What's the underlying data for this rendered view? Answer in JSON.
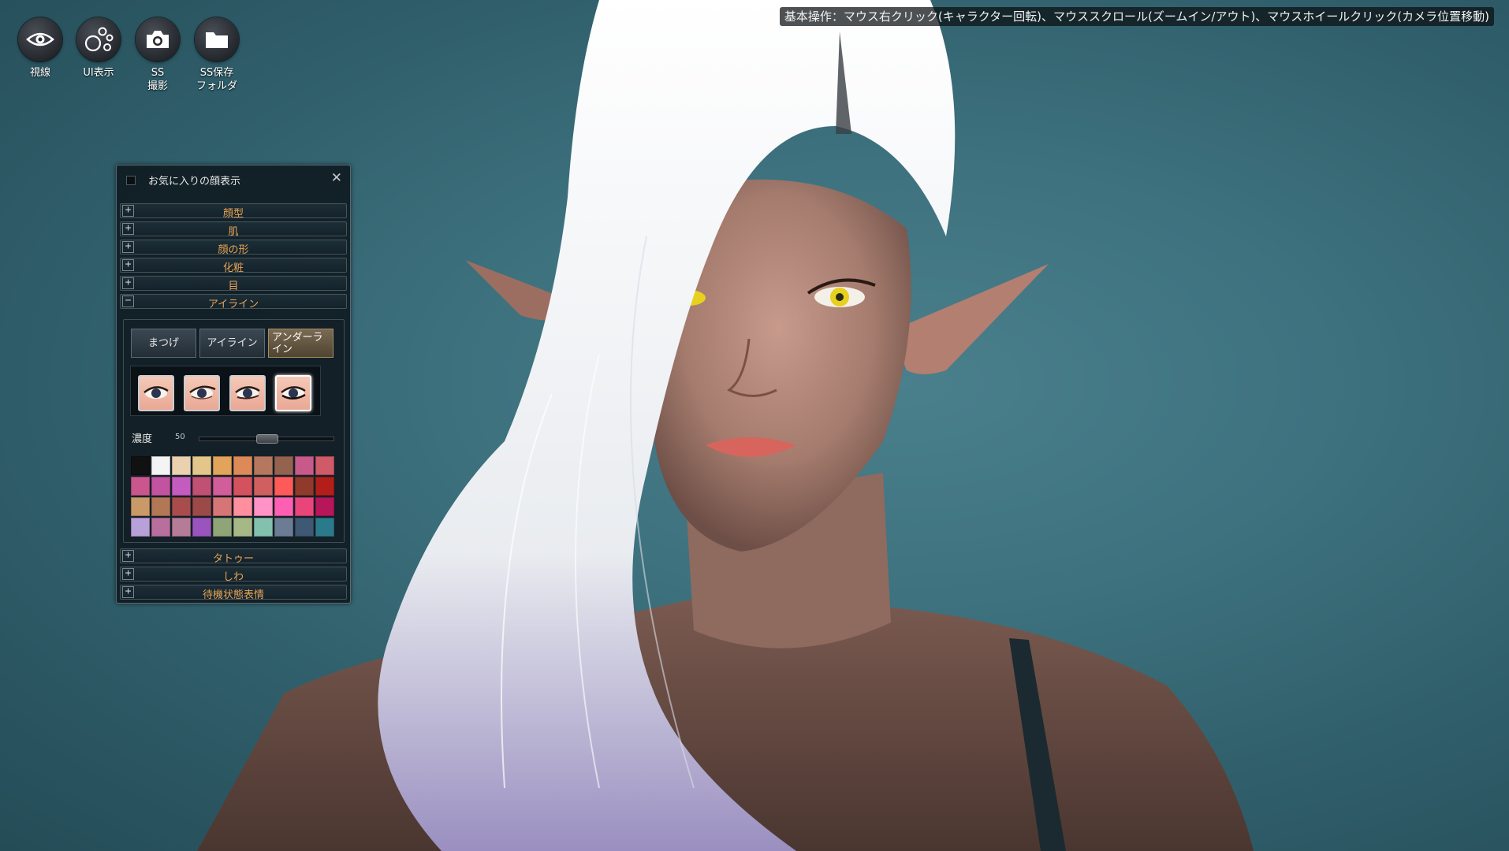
{
  "toolbar": {
    "items": [
      {
        "label": "視線",
        "icon": "eye-icon"
      },
      {
        "label": "UI表示",
        "icon": "bubbles-icon"
      },
      {
        "label": "SS\n撮影",
        "icon": "camera-icon"
      },
      {
        "label": "SS保存\nフォルダ",
        "icon": "folder-icon"
      }
    ]
  },
  "hint": "基本操作：マウス右クリック(キャラクター回転)、マウススクロール(ズームイン/アウト)、マウスホイールクリック(カメラ位置移動)",
  "panel": {
    "favorite_label": "お気に入りの顔表示",
    "close": "✕",
    "sections_top": [
      {
        "label": "顔型",
        "state": "+"
      },
      {
        "label": "肌",
        "state": "+"
      },
      {
        "label": "顔の形",
        "state": "+"
      },
      {
        "label": "化粧",
        "state": "+"
      },
      {
        "label": "目",
        "state": "+"
      },
      {
        "label": "アイライン",
        "state": "−"
      }
    ],
    "tabs": [
      "まつげ",
      "アイライン",
      "アンダーライン"
    ],
    "active_tab": "アンダーライン",
    "eye_options_count": 4,
    "selected_eye_option": 4,
    "density_label": "濃度",
    "density_value": "50",
    "density_fraction": 0.5,
    "palette": [
      [
        "#111111",
        "#f4f4f4",
        "#ead2b0",
        "#e3c78a",
        "#e1a45a",
        "#dd8a58",
        "#b5785f",
        "#94634f",
        "#c75a8b",
        "#cf5a68"
      ],
      [
        "#c9578d",
        "#c153a1",
        "#c45bbf",
        "#c05074",
        "#d15d9a",
        "#d4525e",
        "#d06060",
        "#ff5a5a",
        "#8f3a2a",
        "#b41e1a"
      ],
      [
        "#c99a67",
        "#b27755",
        "#a84c4c",
        "#9c4a48",
        "#d67575",
        "#ff8e9e",
        "#ff92c6",
        "#ff5fb2",
        "#e9457a",
        "#b8165a"
      ],
      [
        "#b8a0d8",
        "#b96f9e",
        "#b47c97",
        "#9a54be",
        "#90a577",
        "#a6b886",
        "#84c0ae",
        "#6c7c94",
        "#3f5873",
        "#2b7a8b"
      ]
    ],
    "sections_bottom": [
      {
        "label": "タトゥー",
        "state": "+"
      },
      {
        "label": "しわ",
        "state": "+"
      },
      {
        "label": "待機状態表情",
        "state": "+"
      }
    ]
  },
  "colors": {
    "section_text": "#e8a456",
    "background": "#3d717e",
    "hair": "#f2f4f6",
    "skin": "#a47b6d",
    "eye_iris": "#e8d020"
  }
}
